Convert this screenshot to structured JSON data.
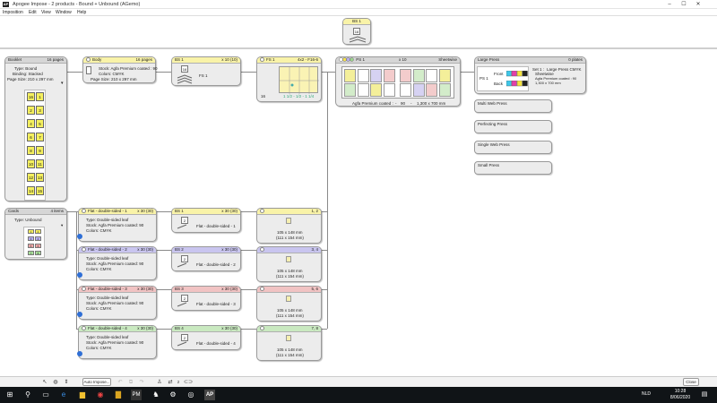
{
  "window": {
    "title": "Apogee Impose - 2 products - Bound + Unbound (AGemo)"
  },
  "menu": [
    "Imposition",
    "Edit",
    "View",
    "Window",
    "Help"
  ],
  "top_bs": {
    "label": "BS 1",
    "count": "16"
  },
  "bound": {
    "booklet": {
      "title": "Booklet",
      "count": "16 pages",
      "type": "Type: Bound",
      "binding": "Binding: Stacked",
      "page_size": "Page Size: 210 x 297 mm",
      "pages": [
        [
          "16",
          "1"
        ],
        [
          "2",
          "3"
        ],
        [
          "4",
          "5"
        ],
        [
          "6",
          "7"
        ],
        [
          "8",
          "9"
        ],
        [
          "10",
          "11"
        ],
        [
          "12",
          "13"
        ],
        [
          "14",
          "15"
        ]
      ]
    },
    "body": {
      "title": "Body",
      "count": "16 pages",
      "stock": "Stock: Agfa Premium coated : 90",
      "colors": "Colors: CMYK",
      "page_size": "Page Size: 210 x 297 mm"
    },
    "bs": {
      "title": "BS 1",
      "count": "x 10 (10)",
      "num": "16",
      "label": "FS 1"
    },
    "fs": {
      "title": "FS 1",
      "count": "4x2 - F16-6",
      "bottom_left": "16",
      "bottom_right": "1 1/2 - 1/2 - 1 1/4"
    },
    "ps": {
      "title": "PS 1",
      "count": "x 10",
      "mode": "Sheetwise",
      "stock": "Agfa Premium coated :",
      "stock_val": "90",
      "size": "1,300 x 700 mm",
      "dash": "-"
    },
    "press": {
      "title": "Large Press",
      "count": "0 plates",
      "ps_label": "PS 1",
      "front": "Front",
      "back": "Back",
      "set": "Set 1 :",
      "set_press": "Large Press CMYK",
      "mode": "Sheetwise",
      "stock": "Agfa Premium coated : 90",
      "size": "1,300 x 700 mm"
    }
  },
  "presses": [
    "Multi Web Press",
    "Perfecting Press",
    "Single Web Press",
    "Small Press"
  ],
  "cards": {
    "title": "Cards",
    "count": "4 items",
    "type": "Type: Unbound"
  },
  "flats": [
    {
      "title": "Flat - double-sided - 1",
      "count": "x 30 (30)",
      "type": "Type: Double-sided leaf",
      "stock": "Stock: Agfa Premium coated: 90",
      "colors": "Colors: CMYK",
      "bs_title": "BS 1",
      "bs_count": "x 30 (30)",
      "bs_label": "Flat - double-sided - 1",
      "fs_count": "1, 2",
      "size1": "105 x 148 mm",
      "size2": "(111 x 154 mm)",
      "color": "yellow"
    },
    {
      "title": "Flat - double-sided - 2",
      "count": "x 30 (30)",
      "type": "Type: Double-sided leaf",
      "stock": "Stock: Agfa Premium coated: 90",
      "colors": "Colors: CMYK",
      "bs_title": "BS 2",
      "bs_count": "x 30 (30)",
      "bs_label": "Flat - double-sided - 2",
      "fs_count": "3, 4",
      "size1": "105 x 148 mm",
      "size2": "(111 x 154 mm)",
      "color": "purple"
    },
    {
      "title": "Flat - double-sided - 3",
      "count": "x 30 (30)",
      "type": "Type: Double-sided leaf",
      "stock": "Stock: Agfa Premium coated: 90",
      "colors": "Colors: CMYK",
      "bs_title": "BS 3",
      "bs_count": "x 30 (30)",
      "bs_label": "Flat - double-sided - 3",
      "fs_count": "5, 6",
      "size1": "105 x 148 mm",
      "size2": "(111 x 154 mm)",
      "color": "pink"
    },
    {
      "title": "Flat - double-sided - 4",
      "count": "x 30 (30)",
      "type": "Type: Double-sided leaf",
      "stock": "Stock: Agfa Premium coated: 90",
      "colors": "Colors: CMYK",
      "bs_title": "BS 4",
      "bs_count": "x 30 (30)",
      "bs_label": "Flat - double-sided - 4",
      "fs_count": "7, 8",
      "size1": "105 x 148 mm",
      "size2": "(111 x 154 mm)",
      "color": "green"
    }
  ],
  "status": {
    "auto_impose": "Auto Impose...",
    "close": "Close",
    "bs_num": "2"
  },
  "taskbar": {
    "time": "10:28",
    "date": "8/06/2020",
    "lang": "NLD"
  }
}
